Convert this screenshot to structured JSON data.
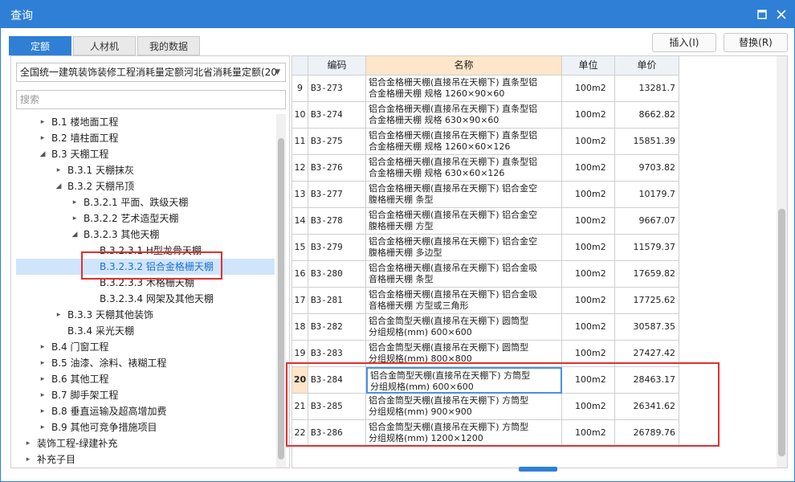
{
  "window": {
    "title": "查询"
  },
  "tabs": [
    {
      "label": "定额",
      "active": true
    },
    {
      "label": "人材机",
      "active": false
    },
    {
      "label": "我的数据",
      "active": false
    }
  ],
  "buttons": {
    "insert": "插入(I)",
    "replace": "替换(R)"
  },
  "library_select": "全国统一建筑装饰装修工程消耗量定额河北省消耗量定额(20",
  "search_placeholder": "搜索",
  "tree": [
    {
      "label": "B.1 楼地面工程",
      "toggle": "▸"
    },
    {
      "label": "B.2 墙柱面工程",
      "toggle": "▸"
    },
    {
      "label": "B.3 天棚工程",
      "toggle": "◢"
    },
    {
      "label": "B.3.1 天棚抹灰",
      "toggle": "▸"
    },
    {
      "label": "B.3.2 天棚吊顶",
      "toggle": "◢"
    },
    {
      "label": "B.3.2.1 平面、跌级天棚",
      "toggle": "▸"
    },
    {
      "label": "B.3.2.2 艺术造型天棚",
      "toggle": "▸"
    },
    {
      "label": "B.3.2.3 其他天棚",
      "toggle": "◢"
    },
    {
      "label": "B.3.2.3.1 H型龙骨天棚",
      "toggle": ""
    },
    {
      "label": "B.3.2.3.2 铝合金格栅天棚",
      "toggle": ""
    },
    {
      "label": "B.3.2.3.3 木格栅天棚",
      "toggle": ""
    },
    {
      "label": "B.3.2.3.4 网架及其他天棚",
      "toggle": ""
    },
    {
      "label": "B.3.3 天棚其他装饰",
      "toggle": "▸"
    },
    {
      "label": "B.3.4 采光天棚",
      "toggle": ""
    },
    {
      "label": "B.4 门窗工程",
      "toggle": "▸"
    },
    {
      "label": "B.5 油漆、涂料、裱糊工程",
      "toggle": "▸"
    },
    {
      "label": "B.6 其他工程",
      "toggle": "▸"
    },
    {
      "label": "B.7 脚手架工程",
      "toggle": "▸"
    },
    {
      "label": "B.8 垂直运输及超高增加费",
      "toggle": "▸"
    },
    {
      "label": "B.9 其他可竞争措施项目",
      "toggle": "▸"
    },
    {
      "label": "装饰工程-绿建补充",
      "toggle": "▸"
    },
    {
      "label": "补充子目",
      "toggle": "▸"
    }
  ],
  "table": {
    "columns": {
      "code": "编码",
      "name": "名称",
      "unit": "单位",
      "price": "单价"
    },
    "rows": [
      {
        "no": "9",
        "code": "B3-273",
        "name1": "铝合金格栅天棚(直接吊在天棚下) 直条型铝",
        "name2": "合金格栅天棚 规格 1260×90×60",
        "unit": "100m2",
        "price": "13281.7"
      },
      {
        "no": "10",
        "code": "B3-274",
        "name1": "铝合金格栅天棚(直接吊在天棚下) 直条型铝",
        "name2": "合金格栅天棚 规格 630×90×60",
        "unit": "100m2",
        "price": "8662.82"
      },
      {
        "no": "11",
        "code": "B3-275",
        "name1": "铝合金格栅天棚(直接吊在天棚下) 直条型铝",
        "name2": "合金格栅天棚 规格 1260×60×126",
        "unit": "100m2",
        "price": "15851.39"
      },
      {
        "no": "12",
        "code": "B3-276",
        "name1": "铝合金格栅天棚(直接吊在天棚下) 直条型铝",
        "name2": "合金格栅天棚 规格 630×60×126",
        "unit": "100m2",
        "price": "9703.82"
      },
      {
        "no": "13",
        "code": "B3-277",
        "name1": "铝合金格栅天棚(直接吊在天棚下) 铝合金空",
        "name2": "腹格栅天棚 条型",
        "unit": "100m2",
        "price": "10179.7"
      },
      {
        "no": "14",
        "code": "B3-278",
        "name1": "铝合金格栅天棚(直接吊在天棚下) 铝合金空",
        "name2": "腹格栅天棚 方型",
        "unit": "100m2",
        "price": "9667.07"
      },
      {
        "no": "15",
        "code": "B3-279",
        "name1": "铝合金格栅天棚(直接吊在天棚下) 铝合金空",
        "name2": "腹格栅天棚 多边型",
        "unit": "100m2",
        "price": "11579.37"
      },
      {
        "no": "16",
        "code": "B3-280",
        "name1": "铝合金格栅天棚(直接吊在天棚下) 铝合金吸",
        "name2": "音格栅天棚 条型",
        "unit": "100m2",
        "price": "17659.82"
      },
      {
        "no": "17",
        "code": "B3-281",
        "name1": "铝合金格栅天棚(直接吊在天棚下) 铝合金吸",
        "name2": "音格栅天棚 方型或三角形",
        "unit": "100m2",
        "price": "17725.62"
      },
      {
        "no": "18",
        "code": "B3-282",
        "name1": "铝合金筒型天棚(直接吊在天棚下) 圆筒型",
        "name2": "分组规格(mm) 600×600",
        "unit": "100m2",
        "price": "30587.35"
      },
      {
        "no": "19",
        "code": "B3-283",
        "name1": "铝合金筒型天棚(直接吊在天棚下) 圆筒型",
        "name2": "分组规格(mm) 800×800",
        "unit": "100m2",
        "price": "27427.42"
      },
      {
        "no": "20",
        "code": "B3-284",
        "name1": "铝合金筒型天棚(直接吊在天棚下) 方筒型",
        "name2": "分组规格(mm) 600×600",
        "unit": "100m2",
        "price": "28463.17"
      },
      {
        "no": "21",
        "code": "B3-285",
        "name1": "铝合金筒型天棚(直接吊在天棚下) 方筒型",
        "name2": "分组规格(mm) 900×900",
        "unit": "100m2",
        "price": "26341.62"
      },
      {
        "no": "22",
        "code": "B3-286",
        "name1": "铝合金筒型天棚(直接吊在天棚下) 方筒型",
        "name2": "分组规格(mm) 1200×1200",
        "unit": "100m2",
        "price": "26789.76"
      }
    ]
  }
}
